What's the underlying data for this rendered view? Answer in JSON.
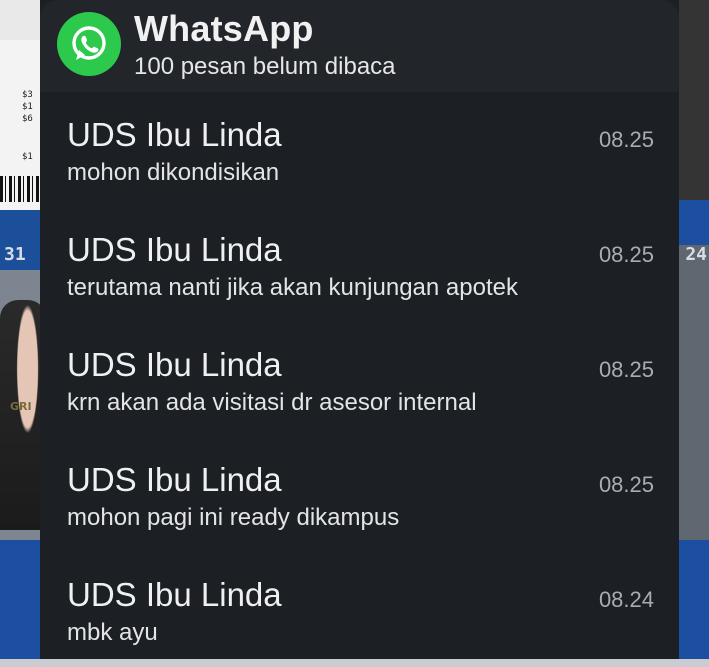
{
  "notification": {
    "app_name": "WhatsApp",
    "summary": "100 pesan belum dibaca",
    "app_icon": "whatsapp-icon",
    "accent": "#2cc94d"
  },
  "messages": [
    {
      "sender": "UDS Ibu Linda",
      "text": "mohon dikondisikan",
      "time": "08.25"
    },
    {
      "sender": "UDS Ibu Linda",
      "text": "terutama nanti jika akan kunjungan apotek",
      "time": "08.25"
    },
    {
      "sender": "UDS Ibu Linda",
      "text": "krn akan ada visitasi dr asesor internal",
      "time": "08.25"
    },
    {
      "sender": "UDS Ibu Linda",
      "text": "mohon pagi ini ready dikampus",
      "time": "08.25"
    },
    {
      "sender": "UDS Ibu Linda",
      "text": "mbk ayu",
      "time": "08.24"
    }
  ],
  "background": {
    "left_number": "31",
    "right_number": "24",
    "receipt_lines": [
      "$3",
      "$1",
      "$6",
      "$1"
    ],
    "figure_text": "GRI"
  }
}
